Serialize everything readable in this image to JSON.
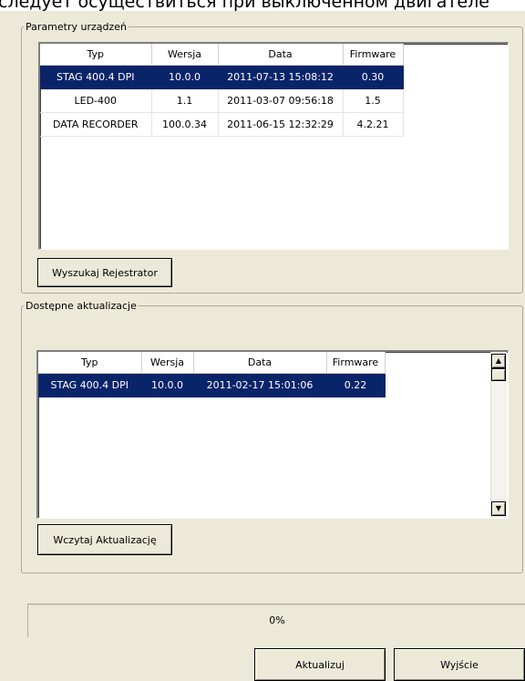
{
  "window": {
    "caption": "следует осуществиться при выключенном двигателе"
  },
  "device_params": {
    "title": "Parametry urządzeń",
    "columns": [
      "Typ",
      "Wersja",
      "Data",
      "Firmware"
    ],
    "rows": [
      {
        "typ": "STAG 400.4 DPI",
        "wersja": "10.0.0",
        "data": "2011-07-13 15:08:12",
        "firmware": "0.30",
        "selected": true
      },
      {
        "typ": "LED-400",
        "wersja": "1.1",
        "data": "2011-03-07 09:56:18",
        "firmware": "1.5",
        "selected": false
      },
      {
        "typ": "DATA RECORDER",
        "wersja": "100.0.34",
        "data": "2011-06-15 12:32:29",
        "firmware": "4.2.21",
        "selected": false
      }
    ],
    "search_button": "Wyszukaj Rejestrator"
  },
  "updates": {
    "title": "Dostępne aktualizacje",
    "columns": [
      "Typ",
      "Wersja",
      "Data",
      "Firmware"
    ],
    "rows": [
      {
        "typ": "STAG 400.4 DPI",
        "wersja": "10.0.0",
        "data": "2011-02-17 15:01:06",
        "firmware": "0.22",
        "selected": true
      }
    ],
    "load_button": "Wczytaj Aktualizację"
  },
  "progress": {
    "value": 0,
    "label": "0%",
    "fill_color": "#316ac5"
  },
  "actions": {
    "update_button": "Aktualizuj",
    "exit_button": "Wyjście"
  },
  "colors": {
    "selection": "#0a246a",
    "window_bg": "#ece9d8"
  },
  "icons": {
    "scroll_up": "arrow-up-icon",
    "scroll_down": "arrow-down-icon"
  }
}
